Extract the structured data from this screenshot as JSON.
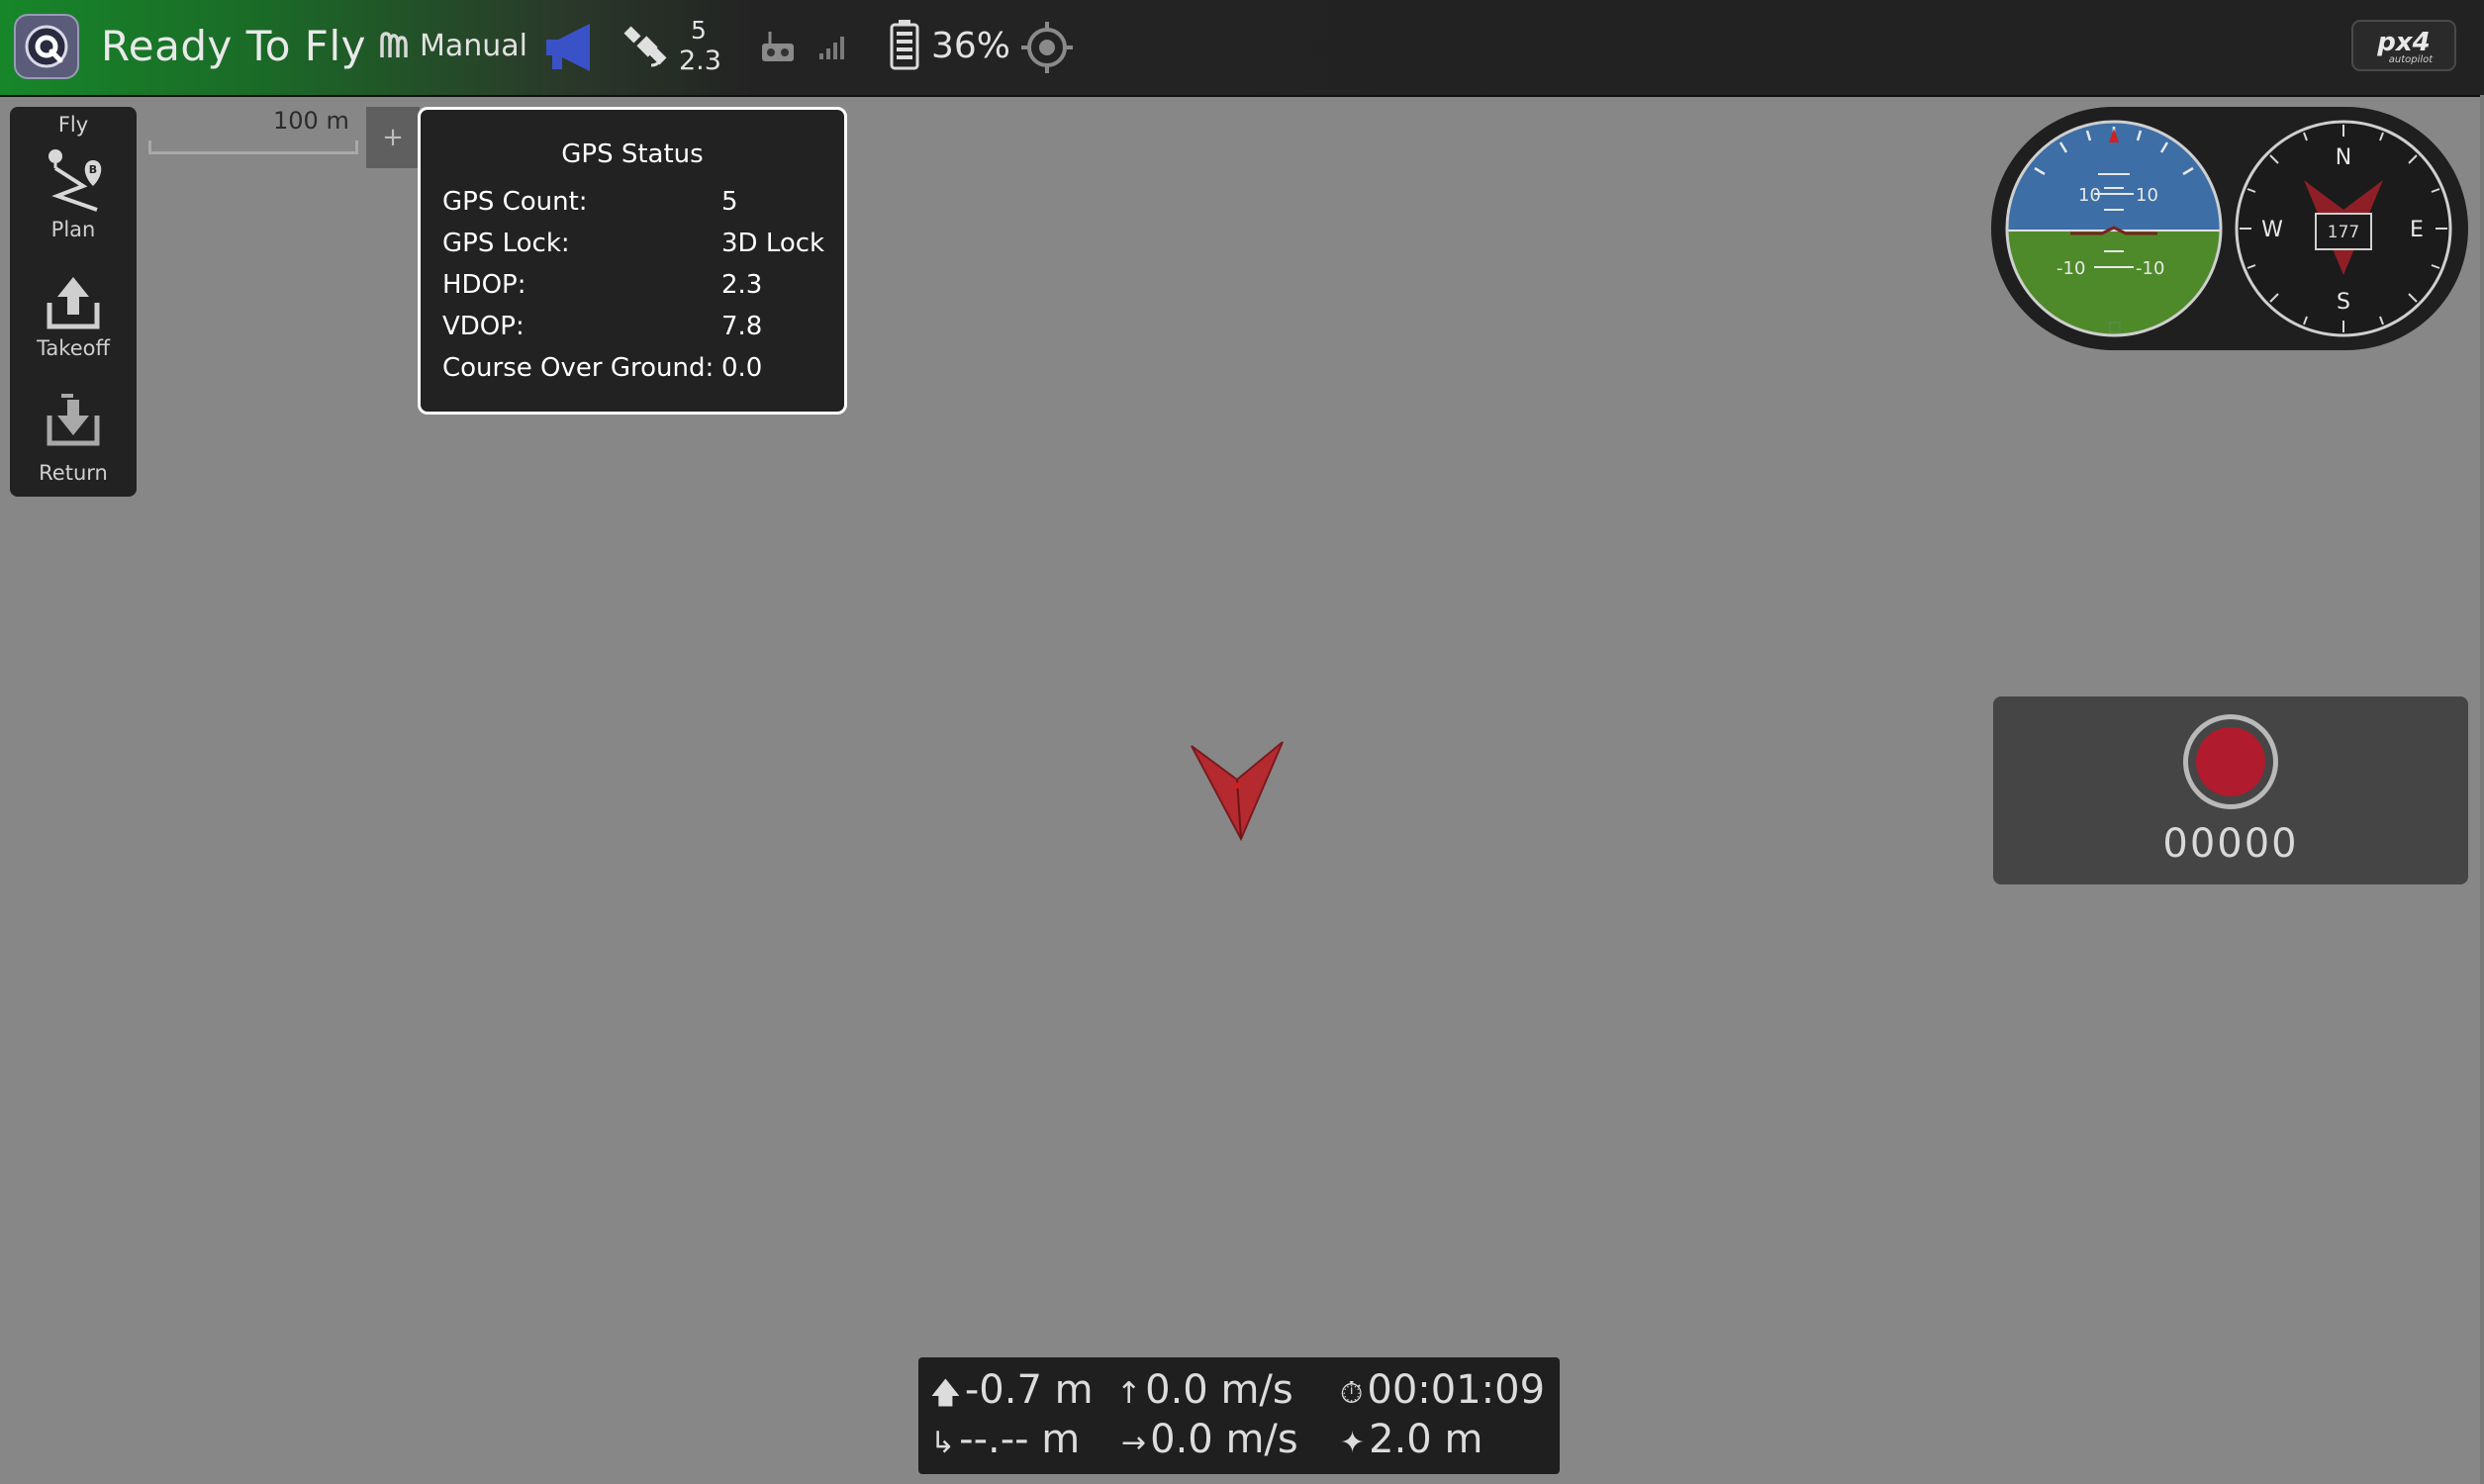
{
  "toolbar": {
    "status": "Ready To Fly",
    "flight_mode": "Manual",
    "gps_count": "5",
    "gps_hdop": "2.3",
    "battery": "36%",
    "brand": "px4 autopilot"
  },
  "tool_strip": {
    "title": "Fly",
    "items": [
      {
        "label": "Plan",
        "icon": "plan-icon"
      },
      {
        "label": "Takeoff",
        "icon": "takeoff-icon"
      },
      {
        "label": "Return",
        "icon": "return-icon"
      }
    ]
  },
  "map": {
    "scale_label": "100 m",
    "zoom_in": "+"
  },
  "gps_popup": {
    "title": "GPS Status",
    "rows": [
      {
        "label": "GPS Count:",
        "value": "5"
      },
      {
        "label": "GPS Lock:",
        "value": "3D Lock"
      },
      {
        "label": "HDOP:",
        "value": "2.3"
      },
      {
        "label": "VDOP:",
        "value": "7.8"
      },
      {
        "label": "Course Over Ground:",
        "value": "0.0"
      }
    ]
  },
  "attitude": {
    "pitch_labels": [
      "10",
      "10",
      "-10",
      "-10"
    ]
  },
  "compass": {
    "heading": "177",
    "north": "N",
    "south": "S",
    "east": "E",
    "west": "W"
  },
  "camera": {
    "record_time": "00000"
  },
  "telemetry": {
    "altitude": "-0.7 m",
    "vertical_speed": "0.0 m/s",
    "flight_time": "00:01:09",
    "distance": "--.-- m",
    "ground_speed": "0.0 m/s",
    "distance_to_home": "2.0 m"
  },
  "colors": {
    "toolbar_green": "#17862a",
    "map_bg": "#878787",
    "panel_bg": "#222222",
    "record_red": "#b01b2e",
    "vehicle_red": "#b52a2f",
    "sky": "#3d6ea6",
    "ground": "#4f8a2a"
  }
}
